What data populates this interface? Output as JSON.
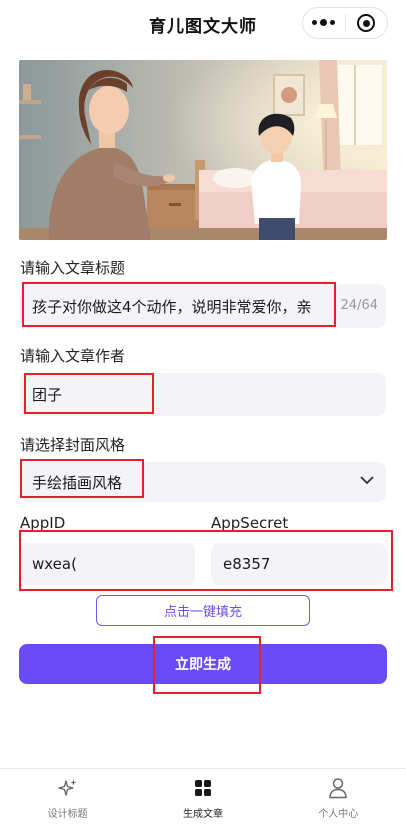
{
  "header": {
    "title": "育儿图文大师"
  },
  "form": {
    "title_label": "请输入文章标题",
    "title_value": "孩子对你做这4个动作，说明非常爱你，亲",
    "title_count": "24/64",
    "author_label": "请输入文章作者",
    "author_value": "团子",
    "style_label": "请选择封面风格",
    "style_value": "手绘插画风格",
    "appid_label": "AppID",
    "appid_value": "wxea(",
    "secret_label": "AppSecret",
    "secret_value": "e8357"
  },
  "buttons": {
    "autofill": "点击一键填充",
    "generate": "立即生成"
  },
  "tabbar": {
    "items": [
      {
        "label": "设计标题",
        "icon": "sparkle-icon"
      },
      {
        "label": "生成文章",
        "icon": "grid-icon"
      },
      {
        "label": "个人中心",
        "icon": "person-icon"
      }
    ],
    "active_index": 1
  },
  "colors": {
    "accent": "#6a4cf6",
    "highlight": "#e4202a",
    "field_bg": "#f3f3f8"
  }
}
